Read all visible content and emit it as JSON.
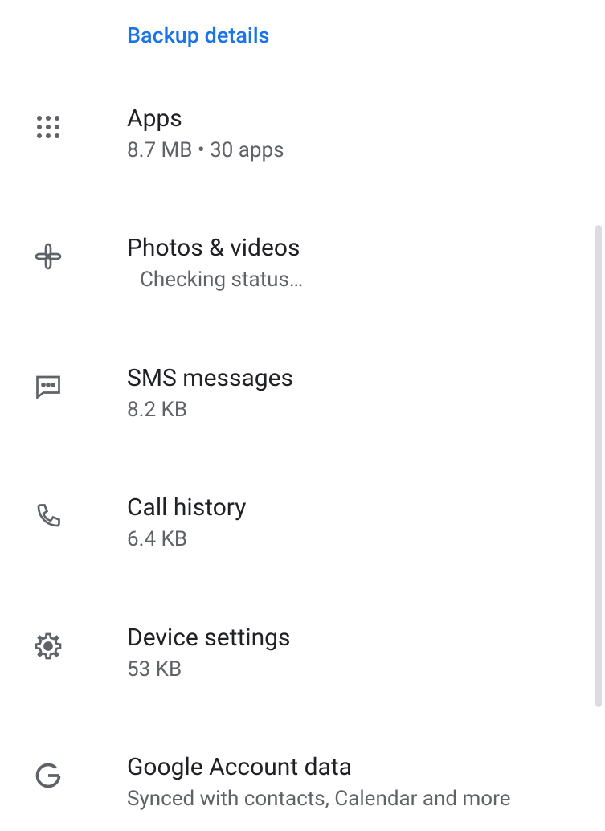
{
  "header": {
    "title": "Backup details"
  },
  "items": [
    {
      "title": "Apps",
      "subtitle": "8.7 MB • 30 apps"
    },
    {
      "title": "Photos & videos",
      "subtitle": "Checking status…"
    },
    {
      "title": "SMS messages",
      "subtitle": "8.2 KB"
    },
    {
      "title": "Call history",
      "subtitle": "6.4 KB"
    },
    {
      "title": "Device settings",
      "subtitle": "53 KB"
    },
    {
      "title": "Google Account data",
      "subtitle": "Synced with contacts, Calendar and more"
    }
  ]
}
